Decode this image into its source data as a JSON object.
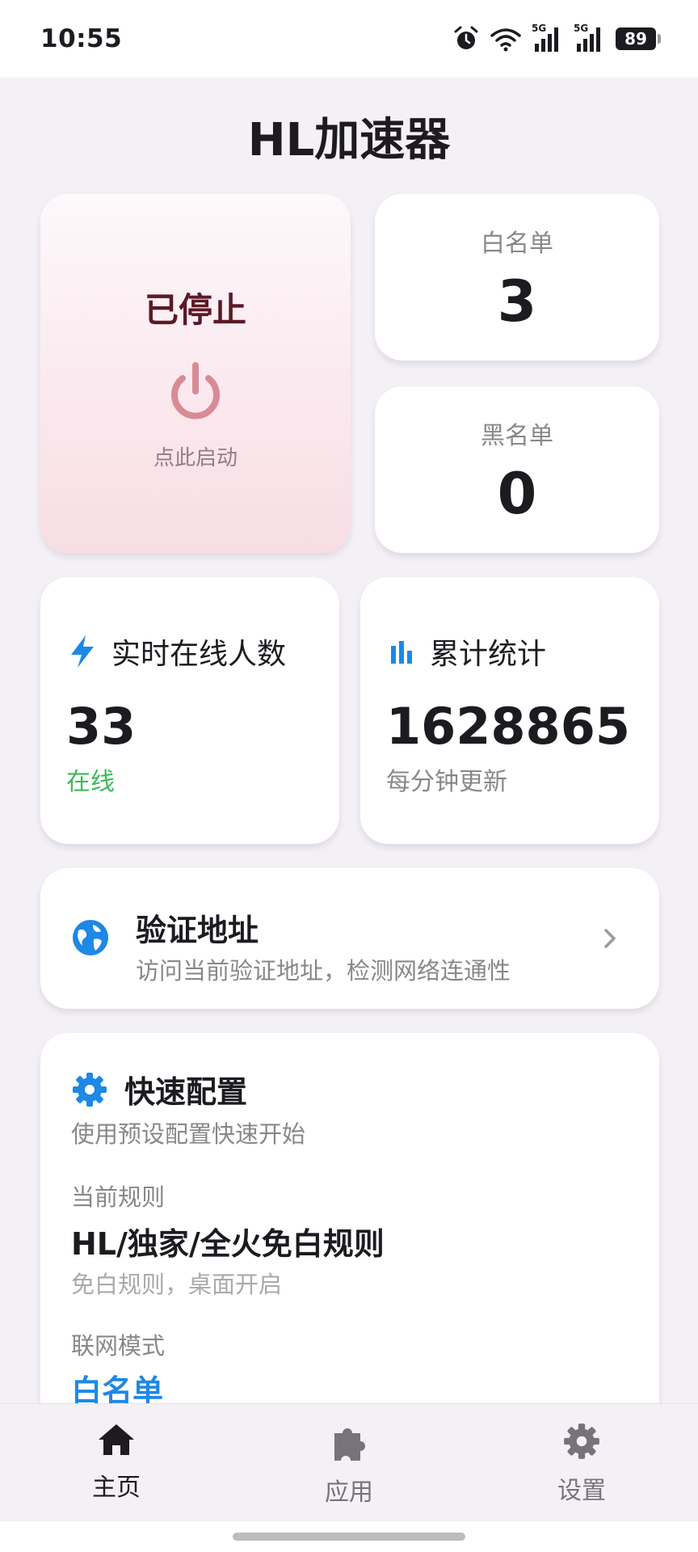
{
  "status_bar": {
    "time": "10:55",
    "signal_1_tag": "5G",
    "signal_2_tag": "5G",
    "battery": "89",
    "icons": [
      "alarm-icon",
      "wifi-icon",
      "signal-icon",
      "signal-icon",
      "battery-icon"
    ]
  },
  "app": {
    "title": "HL加速器"
  },
  "power": {
    "status": "已停止",
    "hint": "点此启动",
    "icon": "power-icon",
    "color": "#d98a95"
  },
  "whitelist": {
    "label": "白名单",
    "count": "3"
  },
  "blacklist": {
    "label": "黑名单",
    "count": "0"
  },
  "online": {
    "label": "实时在线人数",
    "value": "33",
    "status": "在线",
    "icon": "lightning-icon",
    "status_color": "#3cb95c"
  },
  "stats": {
    "label": "累计统计",
    "value": "1628865",
    "note": "每分钟更新",
    "icon": "bar-chart-icon"
  },
  "verify": {
    "title": "验证地址",
    "description": "访问当前验证地址，检测网络连通性",
    "icon": "globe-icon"
  },
  "quick_config": {
    "title": "快速配置",
    "subtitle": "使用预设配置快速开始",
    "rule_label": "当前规则",
    "rule_value": "HL/独家/全火免白规则",
    "rule_desc": "免白规则，桌面开启",
    "mode_label": "联网模式",
    "mode_value": "白名单",
    "icon": "gear-icon"
  },
  "nav": {
    "items": [
      {
        "label": "主页",
        "icon": "home-icon",
        "active": true
      },
      {
        "label": "应用",
        "icon": "puzzle-icon",
        "active": false
      },
      {
        "label": "设置",
        "icon": "settings-icon",
        "active": false
      }
    ]
  },
  "colors": {
    "accent_blue": "#1e88e5",
    "background": "#f4f1f6",
    "card": "#ffffff"
  }
}
